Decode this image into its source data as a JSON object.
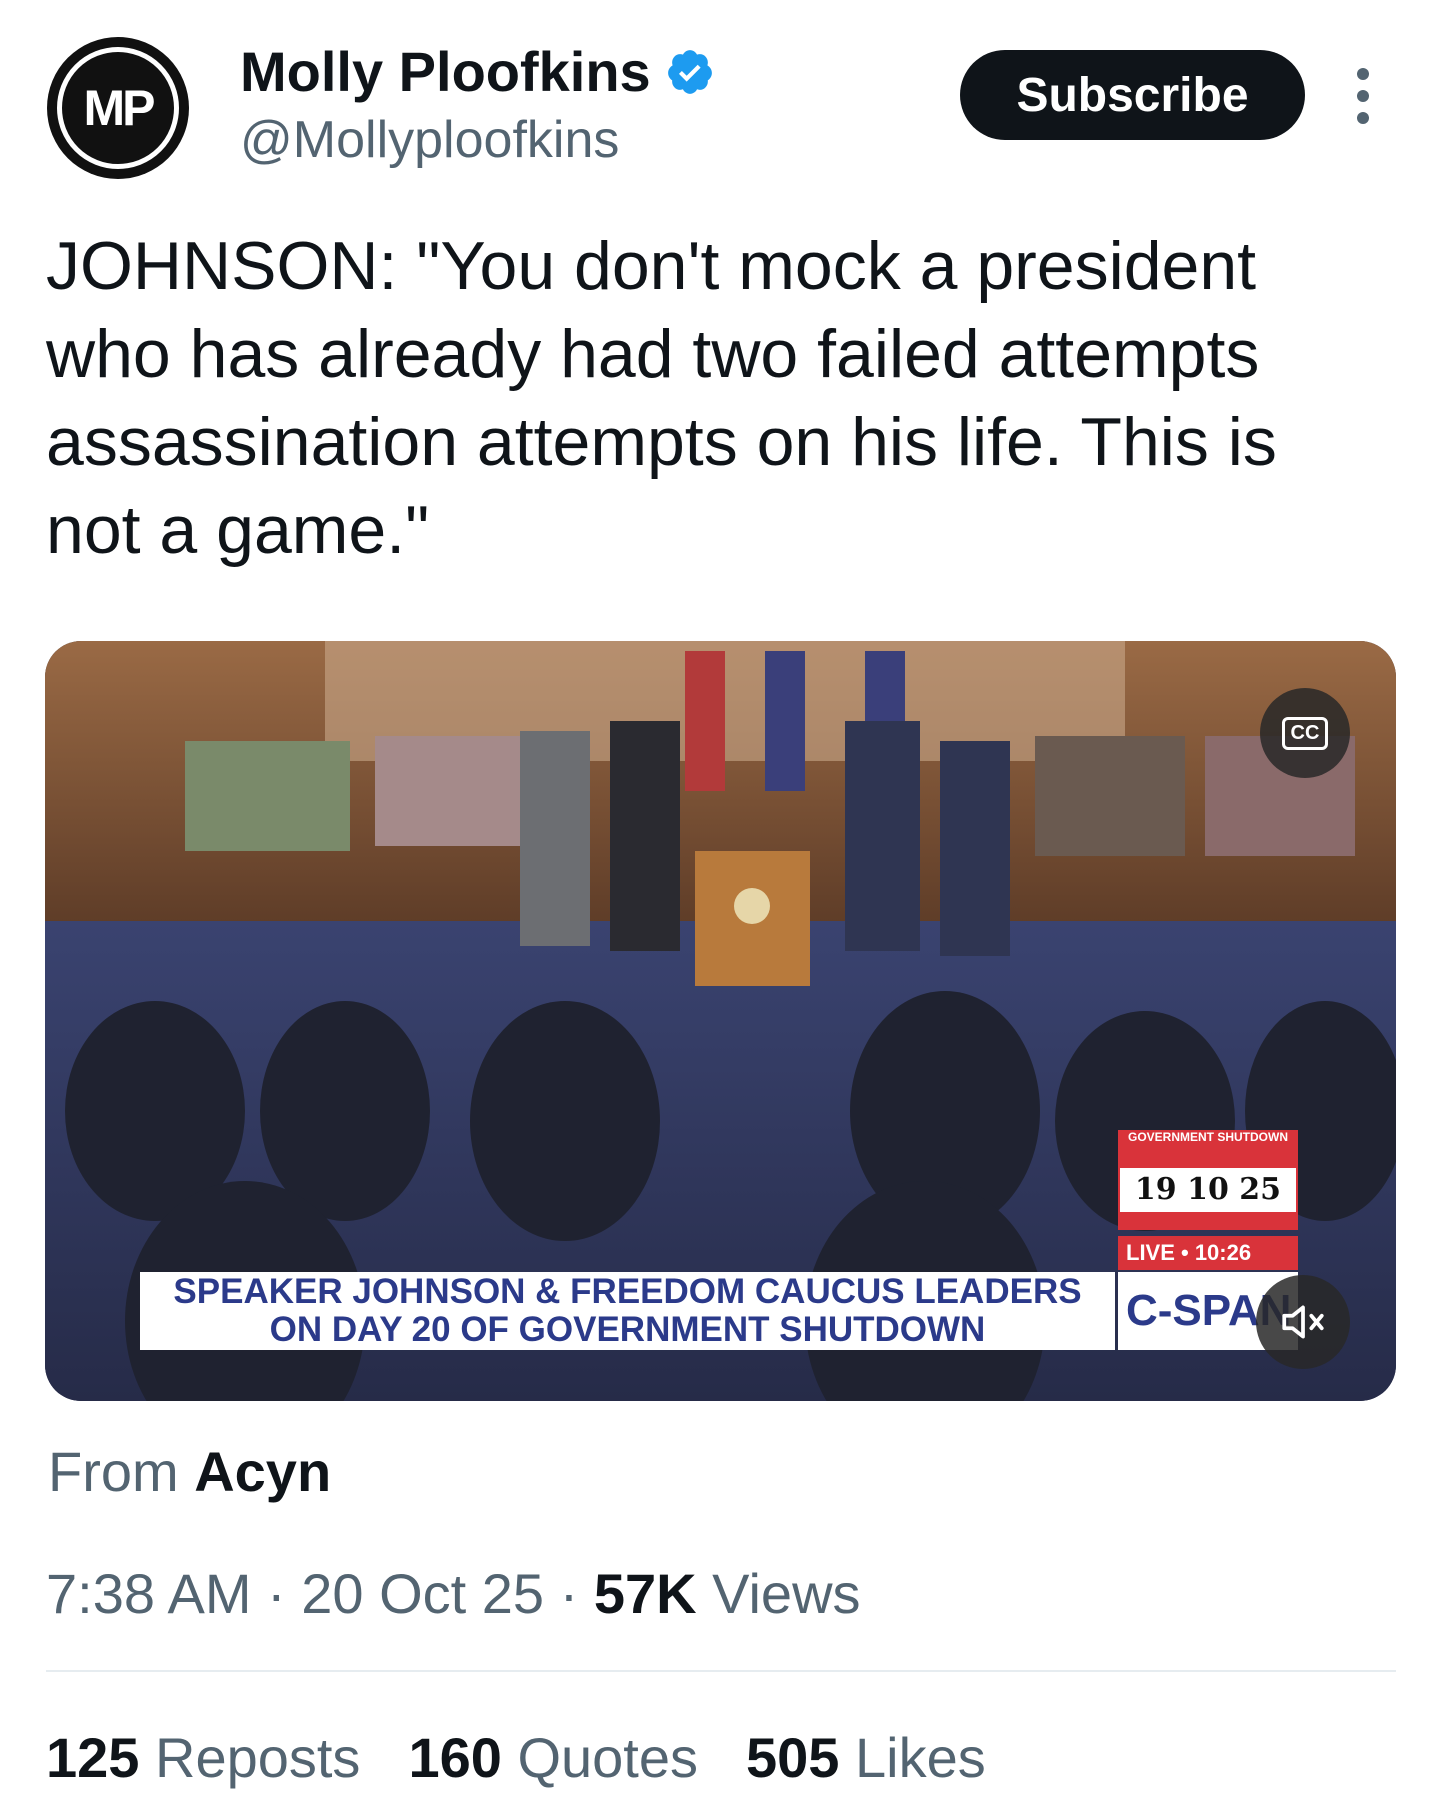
{
  "author": {
    "avatar_initials": "MP",
    "display_name": "Molly Ploofkins",
    "handle": "@Mollyploofkins",
    "verified": true
  },
  "header": {
    "subscribe_label": "Subscribe",
    "more_icon": "more-vertical-icon"
  },
  "tweet": {
    "text": "JOHNSON: \"You don't mock a president who has already had two failed attempts assassination attempts on his life. This is not a game.\""
  },
  "video": {
    "cc_label": "CC",
    "mute_icon": "speaker-muted-icon",
    "lower_third_line1": "SPEAKER JOHNSON & FREEDOM CAUCUS LEADERS",
    "lower_third_line2": "ON DAY 20 OF GOVERNMENT SHUTDOWN",
    "shutdown_title": "GOVERNMENT SHUTDOWN",
    "shutdown_counter": "19 10 25",
    "live_label": "LIVE • 10:26",
    "network": "C-SPAN"
  },
  "source": {
    "prefix": "From",
    "name": "Acyn"
  },
  "meta": {
    "time": "7:38 AM",
    "date": "20 Oct 25",
    "views_count": "57K",
    "views_label": "Views",
    "separator": "·"
  },
  "stats": {
    "reposts_count": "125",
    "reposts_label": "Reposts",
    "quotes_count": "160",
    "quotes_label": "Quotes",
    "likes_count": "505",
    "likes_label": "Likes"
  },
  "colors": {
    "verified_blue": "#1d9bf0",
    "cspan_blue": "#2b3a8a",
    "shutdown_red": "#d9333a"
  }
}
